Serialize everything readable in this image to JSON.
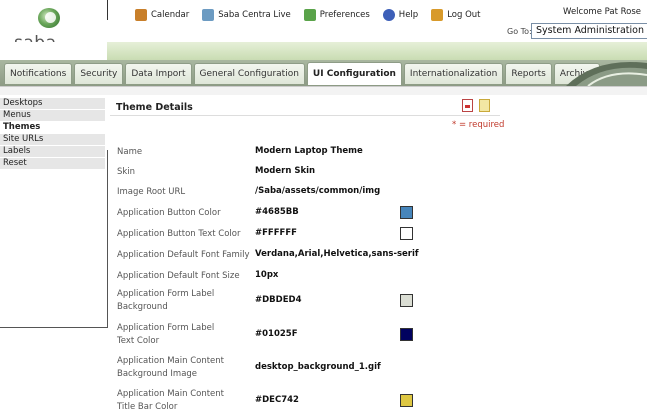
{
  "app": {
    "logo_text": "saba."
  },
  "topnav": {
    "items": [
      {
        "label": "Calendar",
        "icon": "calendar-icon",
        "color": "#c87f2a"
      },
      {
        "label": "Saba Centra Live",
        "icon": "centra-live-icon",
        "color": "#6c9bc2"
      },
      {
        "label": "Preferences",
        "icon": "preferences-icon",
        "color": "#5aa34a"
      },
      {
        "label": "Help",
        "icon": "help-icon",
        "color": "#3d5fb8"
      },
      {
        "label": "Log Out",
        "icon": "logout-icon",
        "color": "#d89a2a"
      }
    ],
    "welcome": "Welcome  Pat Rose",
    "goto_label": "Go To:",
    "goto_value": "System Administration"
  },
  "tabs": [
    {
      "label": "Notifications",
      "active": false
    },
    {
      "label": "Security",
      "active": false
    },
    {
      "label": "Data Import",
      "active": false
    },
    {
      "label": "General Configuration",
      "active": false
    },
    {
      "label": "UI Configuration",
      "active": true
    },
    {
      "label": "Internationalization",
      "active": false
    },
    {
      "label": "Reports",
      "active": false
    },
    {
      "label": "Archive",
      "active": false
    }
  ],
  "sidebar": {
    "items": [
      {
        "label": "Desktops",
        "active": false
      },
      {
        "label": "Menus",
        "active": false
      },
      {
        "label": "Themes",
        "active": true
      },
      {
        "label": "Site URLs",
        "active": false
      },
      {
        "label": "Labels",
        "active": false
      },
      {
        "label": "Reset",
        "active": false
      }
    ]
  },
  "panel": {
    "title": "Theme Details",
    "required_note": "* = required",
    "rows": [
      {
        "label": "Name",
        "value": "Modern Laptop Theme"
      },
      {
        "label": "Skin",
        "value": "Modern Skin"
      },
      {
        "label": "Image Root URL",
        "value": "/Saba/assets/common/img"
      },
      {
        "label": "Application Button Color",
        "value": "#4685BB",
        "swatch": "#4685BB"
      },
      {
        "label": "Application Button Text Color",
        "value": "#FFFFFF",
        "swatch": "#FFFFFF"
      },
      {
        "label": "Application Default Font Family",
        "value": "Verdana,Arial,Helvetica,sans-serif"
      },
      {
        "label": "Application Default Font Size",
        "value": "10px"
      },
      {
        "label": "Application Form Label Background",
        "value": "#DBDED4",
        "swatch": "#DBDED4"
      },
      {
        "label": "Application Form Label Text Color",
        "value": "#01025F",
        "swatch": "#01025F"
      },
      {
        "label": "Application Main Content Background Image",
        "value": "desktop_background_1.gif"
      },
      {
        "label": "Application Main Content Title Bar Color",
        "value": "#DEC742",
        "swatch": "#DEC742"
      }
    ]
  }
}
